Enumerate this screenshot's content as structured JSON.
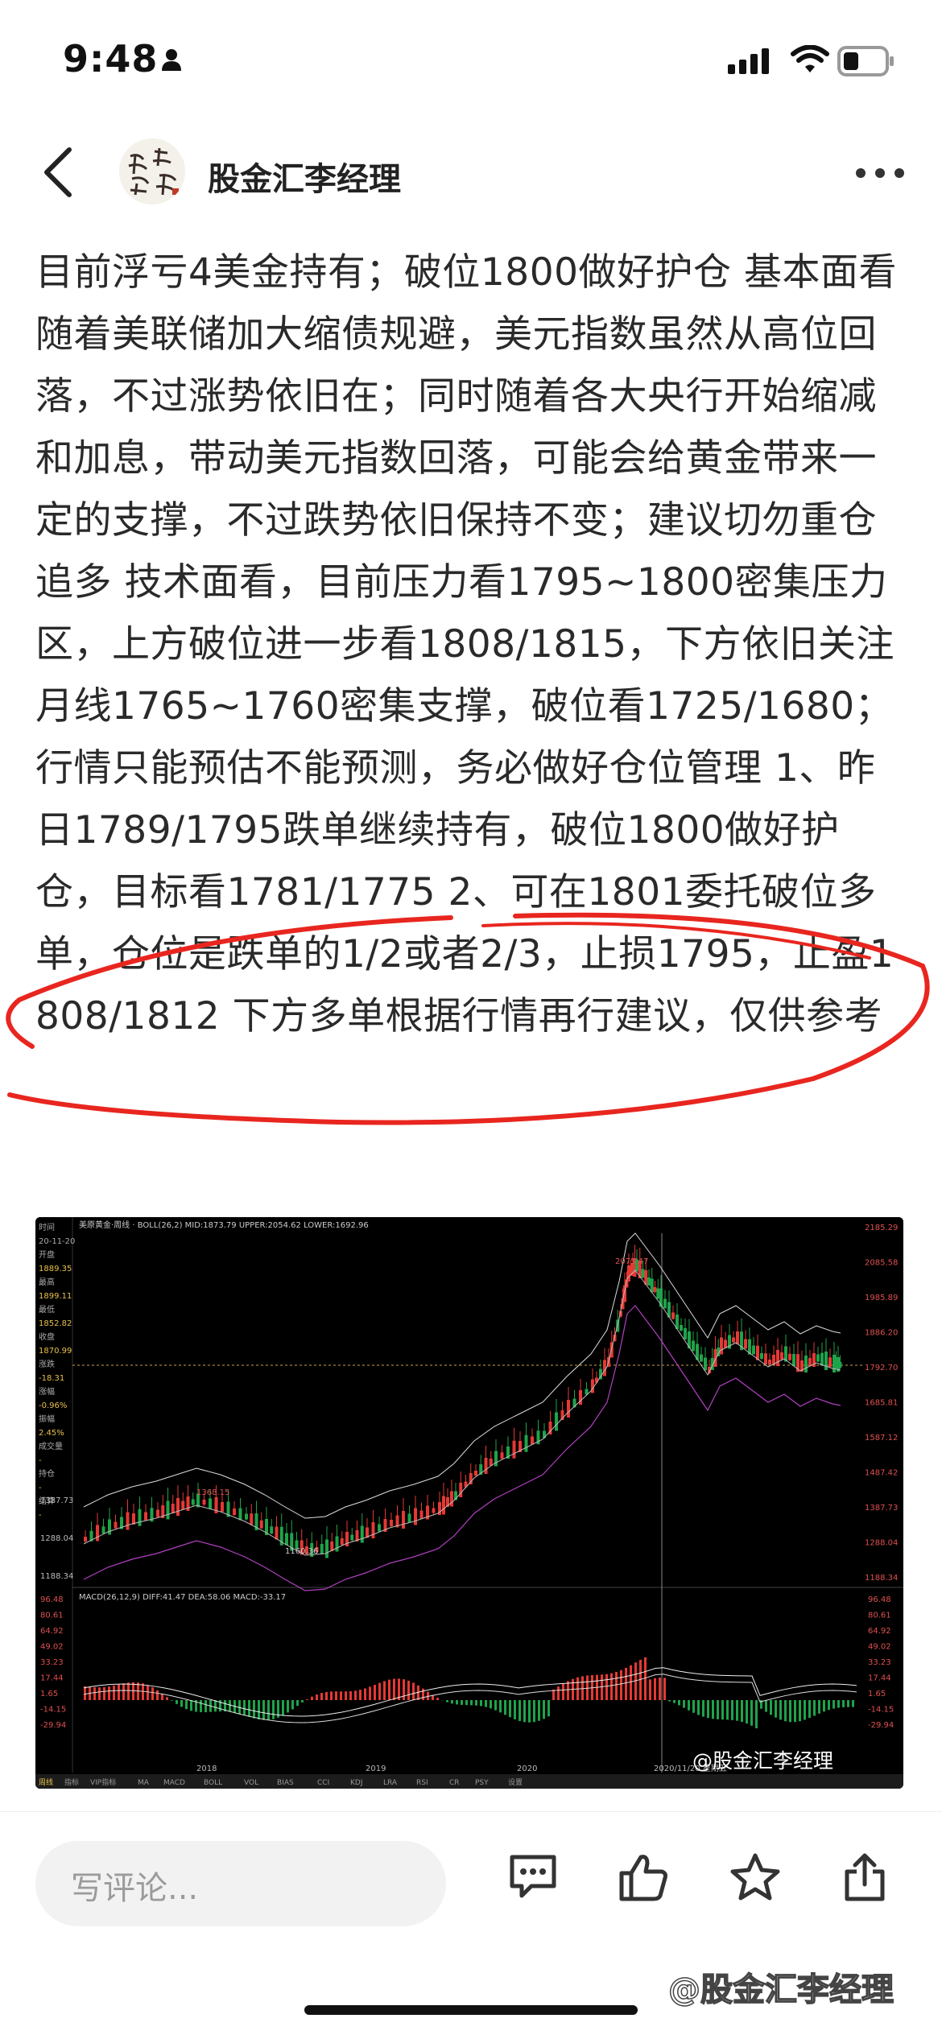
{
  "status_bar": {
    "time": "9:48"
  },
  "header": {
    "author": "股金汇李经理"
  },
  "article": {
    "text": "目前浮亏4美金持有；破位1800做好护仓 基本面看随着美联储加大缩债规避，美元指数虽然从高位回落，不过涨势依旧在；同时随着各大央行开始缩减和加息，带动美元指数回落，可能会给黄金带来一定的支撑，不过跌势依旧保持不变；建议切勿重仓追多 技术面看，目前压力看1795~1800密集压力区，上方破位进一步看1808/1815，下方依旧关注月线1765~1760密集支撑，破位看1725/1680；行情只能预估不能预测，务必做好仓位管理 1、昨日1789/1795跌单继续持有，破位1800做好护仓，目标看1781/1775 2、可在1801委托破位多单，仓位是跌单的1/2或者2/3，止损1795，止盈1808/1812 下方多单根据行情再行建议，仅供参考"
  },
  "chart": {
    "watermark": "@股金汇李经理",
    "title_line": "美原黄金·周线 · BOLL(26,2) MID:1873.79 UPPER:2054.62 LOWER:1692.96",
    "sidebar": [
      "时间",
      "20-11-20",
      "开盘",
      "1889.35",
      "最高",
      "1899.11",
      "最低",
      "1852.82",
      "收盘",
      "1870.99",
      "涨跌",
      "-18.31",
      "涨幅",
      "-0.96%",
      "振幅",
      "2.45%",
      "成交量",
      "-",
      "持仓",
      "-",
      "结算",
      "-"
    ],
    "price_ticks": [
      "2185.29",
      "2085.58",
      "1985.89",
      "1886.20",
      "1792.70",
      "1685.81",
      "1587.12",
      "1487.42",
      "1387.73",
      "1288.04",
      "1188.34"
    ],
    "left_ticks": [
      "1387.73",
      "1288.04",
      "1188.34"
    ],
    "price_labels": {
      "high": "2075.47",
      "low": "1160.36",
      "mid_high": "1368.15"
    },
    "macd_title": "MACD(26,12,9) DIFF:41.47 DEA:58.06 MACD:-33.17",
    "macd_ticks": [
      "96.48",
      "80.61",
      "64.92",
      "49.02",
      "33.23",
      "17.44",
      "1.65",
      "-14.15",
      "-29.94"
    ],
    "years": [
      "2018",
      "2019",
      "2020",
      "2020/11/20 星期五"
    ],
    "tabs": [
      "周线",
      "指标",
      "VIP指标",
      "MA",
      "MACD",
      "BOLL",
      "VOL",
      "BIAS",
      "CCI",
      "KDJ",
      "LRA",
      "RSI",
      "CR",
      "PSY",
      "设置"
    ]
  },
  "bottom_bar": {
    "comment_placeholder": "写评论...",
    "actions": [
      "comment-icon",
      "like-icon",
      "star-icon",
      "share-icon"
    ]
  },
  "footer_watermark": "@股金汇李经理",
  "colors": {
    "up": "#e53935",
    "down": "#1fa34a",
    "ellipse": "#e8261f",
    "chart_bg": "#000000"
  }
}
